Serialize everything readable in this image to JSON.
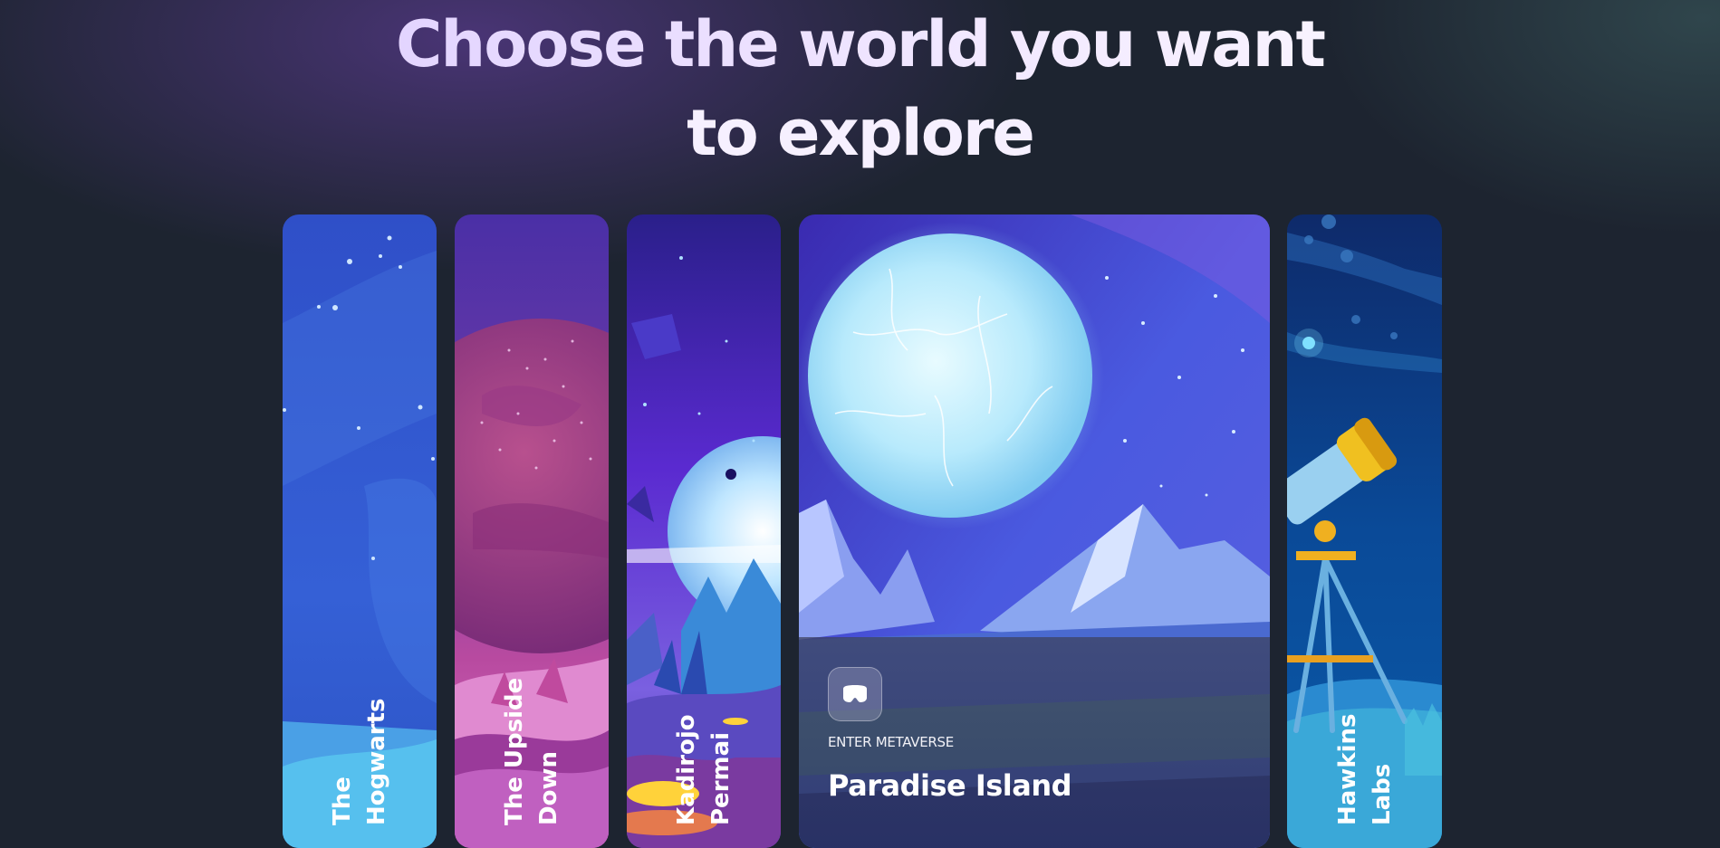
{
  "heading": {
    "line1": "Choose the world you want",
    "line2": "to explore"
  },
  "worlds": [
    {
      "name": "The\nHogwarts"
    },
    {
      "name": "The Upside\nDown"
    },
    {
      "name": "Kadirojo\nPermai"
    },
    {
      "name": "Paradise Island",
      "action_label": "ENTER METAVERSE",
      "icon": "vr-headset-icon",
      "active": true
    },
    {
      "name": "Hawkins\nLabs"
    }
  ],
  "colors": {
    "background": "#1d2430",
    "heading_gradient_start": "#d9c7ff",
    "overlay": "#3c405c"
  }
}
